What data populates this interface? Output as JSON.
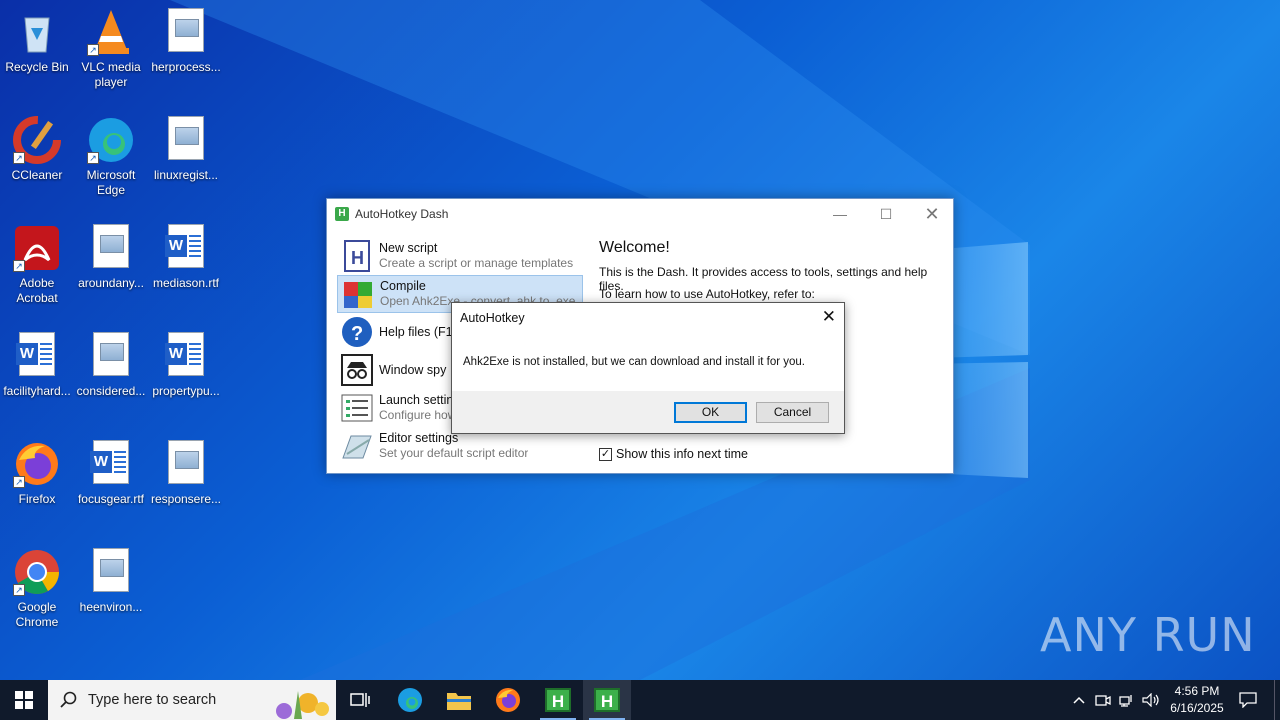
{
  "desktop": {
    "icons": [
      {
        "label": "Recycle Bin"
      },
      {
        "label": "VLC media player"
      },
      {
        "label": "herprocess..."
      },
      {
        "label": "CCleaner"
      },
      {
        "label": "Microsoft Edge"
      },
      {
        "label": "linuxregist..."
      },
      {
        "label": "Adobe Acrobat"
      },
      {
        "label": "aroundany..."
      },
      {
        "label": "mediason.rtf"
      },
      {
        "label": "facilityhard..."
      },
      {
        "label": "considered..."
      },
      {
        "label": "propertypu..."
      },
      {
        "label": "Firefox"
      },
      {
        "label": "focusgear.rtf"
      },
      {
        "label": "responsere..."
      },
      {
        "label": "Google Chrome"
      },
      {
        "label": "heenviron..."
      }
    ],
    "watermark": "ANY RUN"
  },
  "dash": {
    "title": "AutoHotkey Dash",
    "items": [
      {
        "title": "New script",
        "subtitle": "Create a script or manage templates"
      },
      {
        "title": "Compile",
        "subtitle": "Open Ahk2Exe - convert .ahk to .exe"
      },
      {
        "title": "Help files (F1)",
        "subtitle": ""
      },
      {
        "title": "Window spy",
        "subtitle": ""
      },
      {
        "title": "Launch settings",
        "subtitle": "Configure how .ahk files are opened"
      },
      {
        "title": "Editor settings",
        "subtitle": "Set your default script editor"
      }
    ],
    "welcome_title": "Welcome!",
    "welcome_line1": "This is the Dash. It provides access to tools, settings and help files.",
    "welcome_line2": "To learn how to use AutoHotkey, refer to:",
    "show_info_label": "Show this info next time",
    "show_info_checked": true
  },
  "dialog": {
    "title": "AutoHotkey",
    "message": "Ahk2Exe is not installed, but we can download and install it for you.",
    "ok_label": "OK",
    "cancel_label": "Cancel"
  },
  "taskbar": {
    "search_placeholder": "Type here to search",
    "time": "4:56 PM",
    "date": "6/16/2025"
  },
  "colors": {
    "accent": "#0078d7",
    "ahk_green": "#3cb04a",
    "selection": "#cde2f7"
  }
}
